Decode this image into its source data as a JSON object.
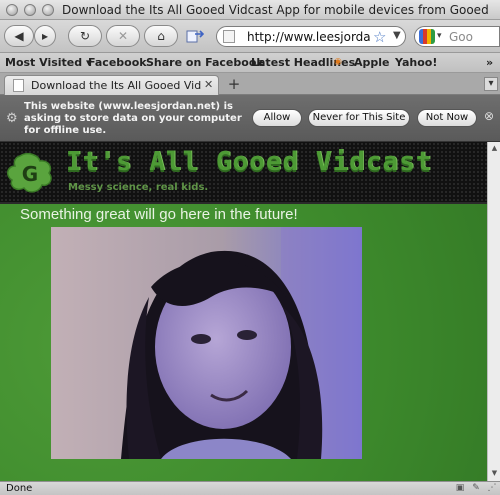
{
  "window": {
    "title": "Download the Its All Gooed Vidcast App for mobile devices from Gooed"
  },
  "navbar": {
    "back_label": "◀",
    "forward_label": "▸",
    "reload_label": "↻",
    "stop_label": "✕",
    "home_label": "⌂",
    "url": "http://www.leesjordan",
    "search_placeholder": "Goo"
  },
  "bookmarks": {
    "items": [
      "Most Visited ▾",
      "Facebook",
      "Share on Facebook",
      "Latest Headlines",
      "Apple",
      "Yahoo!"
    ],
    "overflow": "»"
  },
  "tabs": {
    "items": [
      {
        "label": "Download the Its All Gooed Vidca"
      }
    ],
    "new_tab": "+"
  },
  "notification": {
    "message": "This website (www.leesjordan.net) is asking to store data on your computer for offline use.",
    "buttons": [
      "Allow",
      "Never for This Site",
      "Not Now"
    ]
  },
  "page": {
    "logo_letter": "G",
    "site_title": "It's All Gooed Vidcast",
    "tagline": "Messy science, real kids.",
    "placeholder_text": "Something great will go here in the future!"
  },
  "status": {
    "text": "Done"
  },
  "colors": {
    "page_green": "#3d8a2c",
    "title_green": "#4d9a35",
    "header_dark": "#151515",
    "notification_gray": "#666666"
  }
}
